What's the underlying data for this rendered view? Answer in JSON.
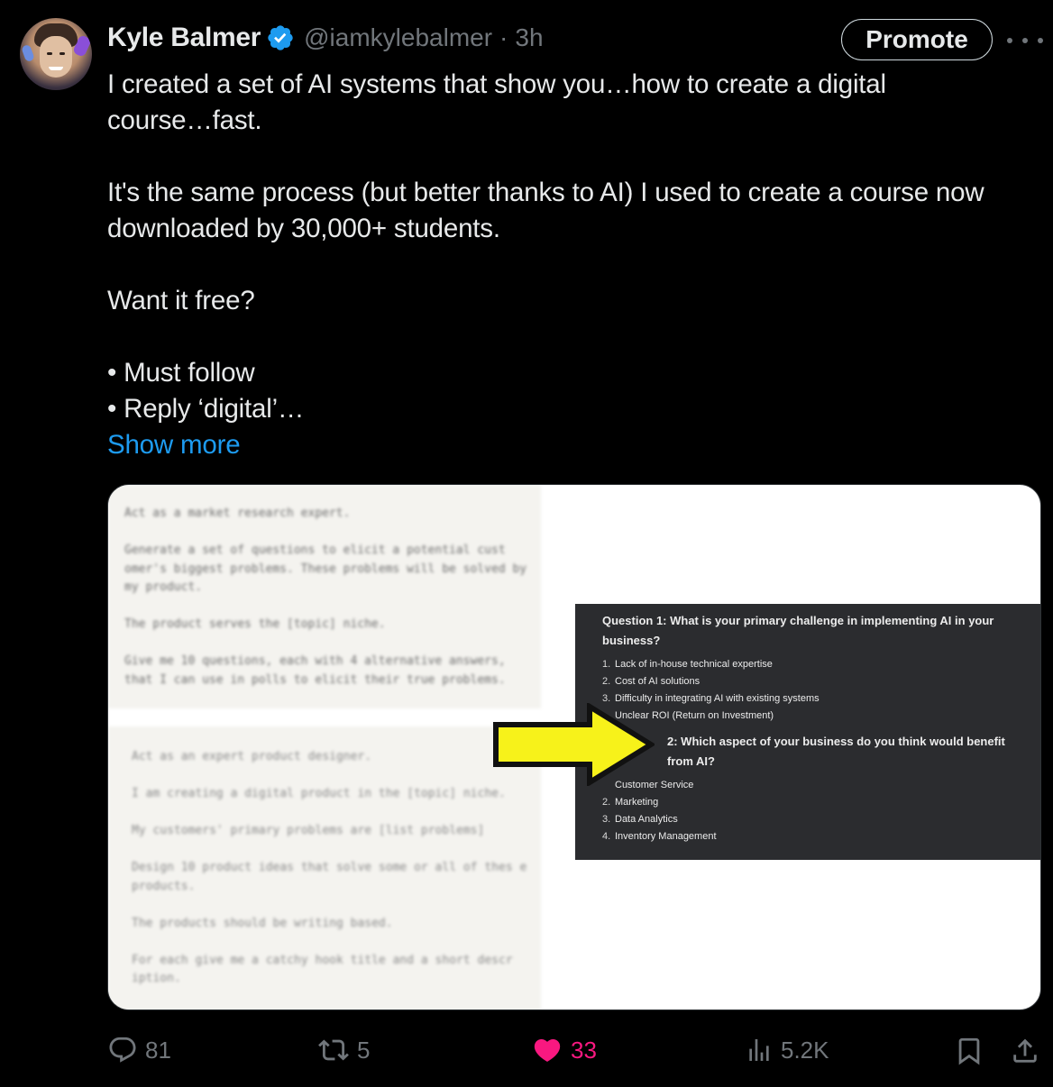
{
  "author": {
    "name": "Kyle Balmer",
    "handle": "@iamkylebalmer",
    "separator": "·",
    "time": "3h"
  },
  "promote_label": "Promote",
  "tweet": {
    "line1": "I created a set of AI systems that show you…how to create a digital",
    "line2": "course…fast.",
    "line3": "It's the same process (but better thanks to AI) I used to create a course now",
    "line4": "downloaded by 30,000+ students.",
    "line5": "Want it free?",
    "line6": "• Must follow",
    "line7": "• Reply ‘digital’…",
    "show_more": "Show more"
  },
  "media": {
    "blur_a": [
      "Act as a market research expert.",
      "Generate a set of questions to elicit a potential cust omer's biggest problems. These problems will be solved by my product.",
      "The product serves the [topic] niche.",
      "Give me 10 questions, each with 4 alternative answers, that I can use in polls to elicit their true problems."
    ],
    "blur_b": [
      "Act as an expert product designer.",
      "I am creating a digital product in the [topic] niche.",
      "My customers' primary problems are [list problems]",
      "Design 10 product ideas that solve some or all of thes e products.",
      "The products should be writing based.",
      "For each give me a catchy hook title and a short descr iption."
    ],
    "q1": "Question 1: What is your primary challenge in implementing AI in your business?",
    "q1_items": [
      {
        "n": "1.",
        "t": "Lack of in-house technical expertise"
      },
      {
        "n": "2.",
        "t": "Cost of AI solutions"
      },
      {
        "n": "3.",
        "t": "Difficulty in integrating AI with existing systems"
      },
      {
        "n": "",
        "t": "Unclear ROI (Return on Investment)"
      }
    ],
    "q2": "2: Which aspect of your business do you think would benefit from AI?",
    "q2_items": [
      {
        "n": "",
        "t": "Customer Service"
      },
      {
        "n": "2.",
        "t": "Marketing"
      },
      {
        "n": "3.",
        "t": "Data Analytics"
      },
      {
        "n": "4.",
        "t": "Inventory Management"
      }
    ],
    "arrow_color": "#f7f21a"
  },
  "actions": {
    "replies": "81",
    "reposts": "5",
    "likes": "33",
    "views": "5.2K",
    "like_color": "#f91880"
  },
  "icons": [
    "verified-badge-icon",
    "more-icon",
    "reply-icon",
    "repost-icon",
    "heart-icon",
    "views-icon",
    "bookmark-icon",
    "share-icon"
  ]
}
